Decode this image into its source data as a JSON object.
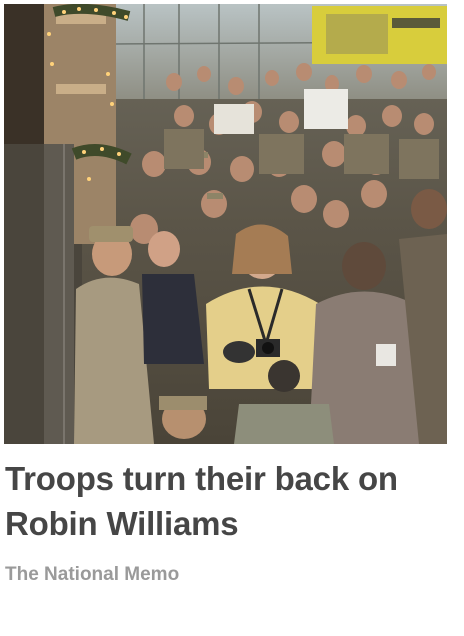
{
  "article": {
    "headline": "Troops turn their back on Robin Williams",
    "source": "The National Memo",
    "image": {
      "alt": "Crowd of troops standing facing a stage"
    }
  },
  "colors": {
    "headline": "#464646",
    "source": "#9a9a9a",
    "background": "#ffffff"
  }
}
